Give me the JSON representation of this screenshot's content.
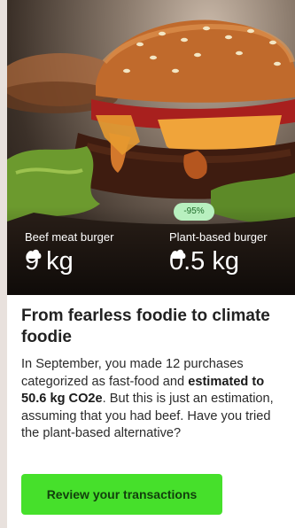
{
  "hero": {
    "badge": "-95%",
    "left": {
      "label": "Beef meat burger",
      "value": "9 kg",
      "icon": "cloud-icon"
    },
    "right": {
      "label": "Plant-based burger",
      "value": "0.5 kg",
      "icon": "cloud-icon"
    }
  },
  "article": {
    "title": "From fearless foodie to climate foodie",
    "body_pre": "In September, you made 12 purchases categorized as fast-food and ",
    "body_bold": "estimated to 50.6 kg CO2e",
    "body_post": ". But this is just an estimation, assuming that you had beef. Have you tried the plant-based alternative?"
  },
  "cta": {
    "label": "Review your transactions"
  },
  "colors": {
    "accent": "#46e02b",
    "badge_bg": "#b8f0bf",
    "badge_text": "#1f6b2a"
  }
}
